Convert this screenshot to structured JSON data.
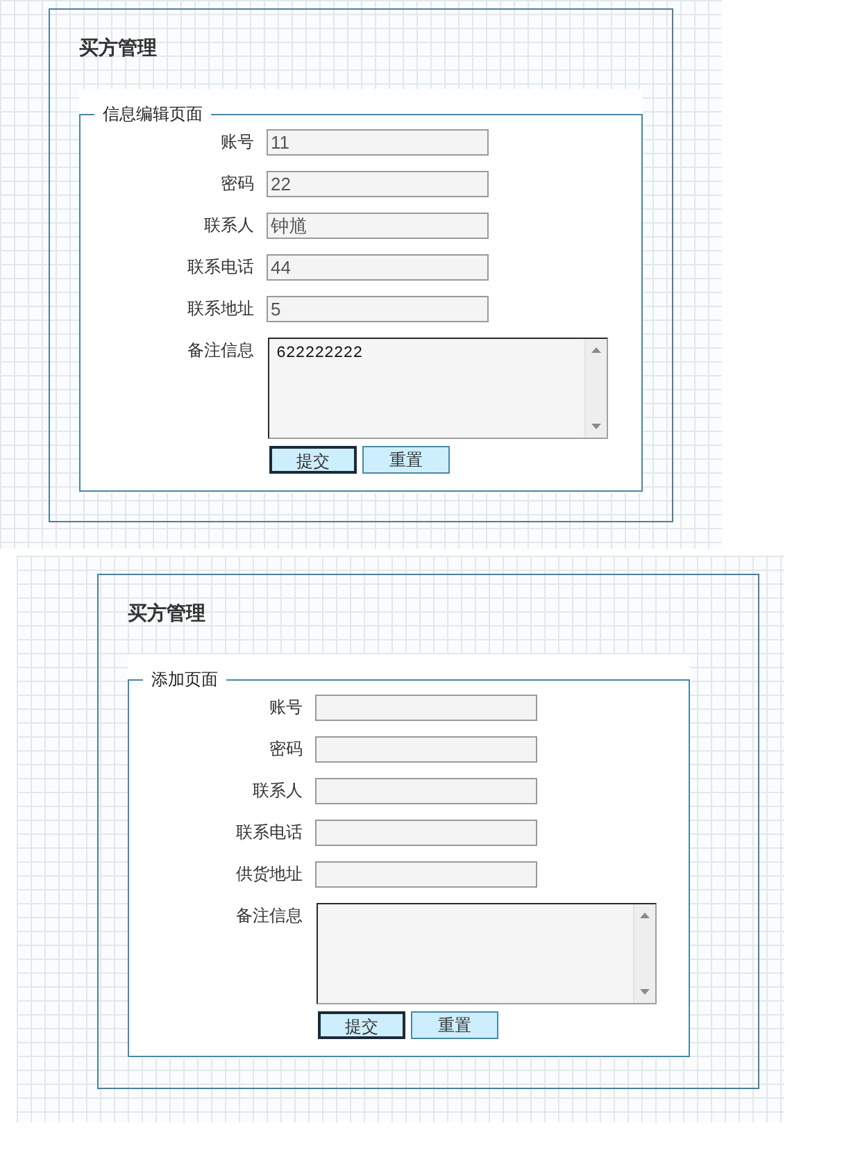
{
  "panels": [
    {
      "title": "买方管理",
      "form": {
        "legend": "信息编辑页面",
        "fields": [
          {
            "kind": "input",
            "label": "账号",
            "value": "11"
          },
          {
            "kind": "input",
            "label": "密码",
            "value": "22"
          },
          {
            "kind": "input",
            "label": "联系人",
            "value": "钟馗"
          },
          {
            "kind": "input",
            "label": "联系电话",
            "value": "44"
          },
          {
            "kind": "input",
            "label": "联系地址",
            "value": "5"
          },
          {
            "kind": "textarea",
            "label": "备注信息",
            "value": "622222222"
          }
        ],
        "buttons": [
          {
            "label": "提交",
            "focused": true
          },
          {
            "label": "重置",
            "focused": false
          }
        ]
      }
    },
    {
      "title": "买方管理",
      "form": {
        "legend": "添加页面",
        "fields": [
          {
            "kind": "input",
            "label": "账号"
          },
          {
            "kind": "input",
            "label": "密码"
          },
          {
            "kind": "input",
            "label": "联系人"
          },
          {
            "kind": "input",
            "label": "联系电话"
          },
          {
            "kind": "input",
            "label": "供货地址"
          },
          {
            "kind": "textarea",
            "label": "备注信息"
          }
        ],
        "buttons": [
          {
            "label": "提交",
            "focused": true
          },
          {
            "label": "重置",
            "focused": false
          }
        ]
      }
    }
  ]
}
